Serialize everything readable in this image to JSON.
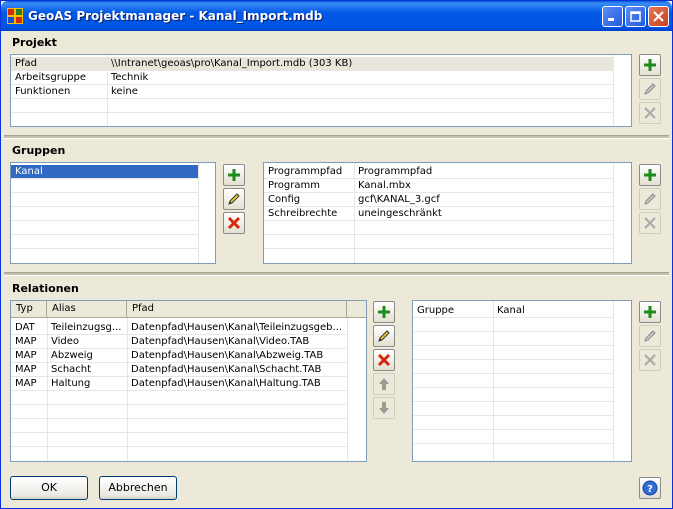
{
  "window": {
    "title": "GeoAS Projektmanager - Kanal_Import.mdb"
  },
  "projekt": {
    "title": "Projekt",
    "rows": [
      {
        "key": "Pfad",
        "value": "\\\\Intranet\\geoas\\pro\\Kanal_Import.mdb    (303 KB)"
      },
      {
        "key": "Arbeitsgruppe",
        "value": "Technik"
      },
      {
        "key": "Funktionen",
        "value": "keine"
      }
    ]
  },
  "gruppen": {
    "title": "Gruppen",
    "items": [
      "Kanal"
    ],
    "properties": [
      {
        "key": "Programmpfad",
        "value": "Programmpfad"
      },
      {
        "key": "Programm",
        "value": "Kanal.mbx"
      },
      {
        "key": "Config",
        "value": "gcf\\KANAL_3.gcf"
      },
      {
        "key": "Schreibrechte",
        "value": "uneingeschränkt"
      }
    ]
  },
  "relationen": {
    "title": "Relationen",
    "columns": [
      "Typ",
      "Alias",
      "Pfad"
    ],
    "rows": [
      {
        "typ": "DAT",
        "alias": "Teileinzugsg...",
        "pfad": "Datenpfad\\Hausen\\Kanal\\Teileinzugsgeb..."
      },
      {
        "typ": "MAP",
        "alias": "Video",
        "pfad": "Datenpfad\\Hausen\\Kanal\\Video.TAB"
      },
      {
        "typ": "MAP",
        "alias": "Abzweig",
        "pfad": "Datenpfad\\Hausen\\Kanal\\Abzweig.TAB"
      },
      {
        "typ": "MAP",
        "alias": "Schacht",
        "pfad": "Datenpfad\\Hausen\\Kanal\\Schacht.TAB"
      },
      {
        "typ": "MAP",
        "alias": "Haltung",
        "pfad": "Datenpfad\\Hausen\\Kanal\\Haltung.TAB"
      }
    ],
    "properties": [
      {
        "key": "Gruppe",
        "value": "Kanal"
      }
    ]
  },
  "buttons": {
    "ok": "OK",
    "cancel": "Abbrechen"
  },
  "icons": {
    "add": "plus-icon",
    "edit": "pencil-icon",
    "delete": "x-icon",
    "up": "arrow-up-icon",
    "down": "arrow-down-icon",
    "help": "help-icon"
  },
  "colors": {
    "add": "#1E8A1E",
    "delete": "#D42A0F",
    "selection": "#316AC5",
    "titlebar": "#0054E3"
  }
}
